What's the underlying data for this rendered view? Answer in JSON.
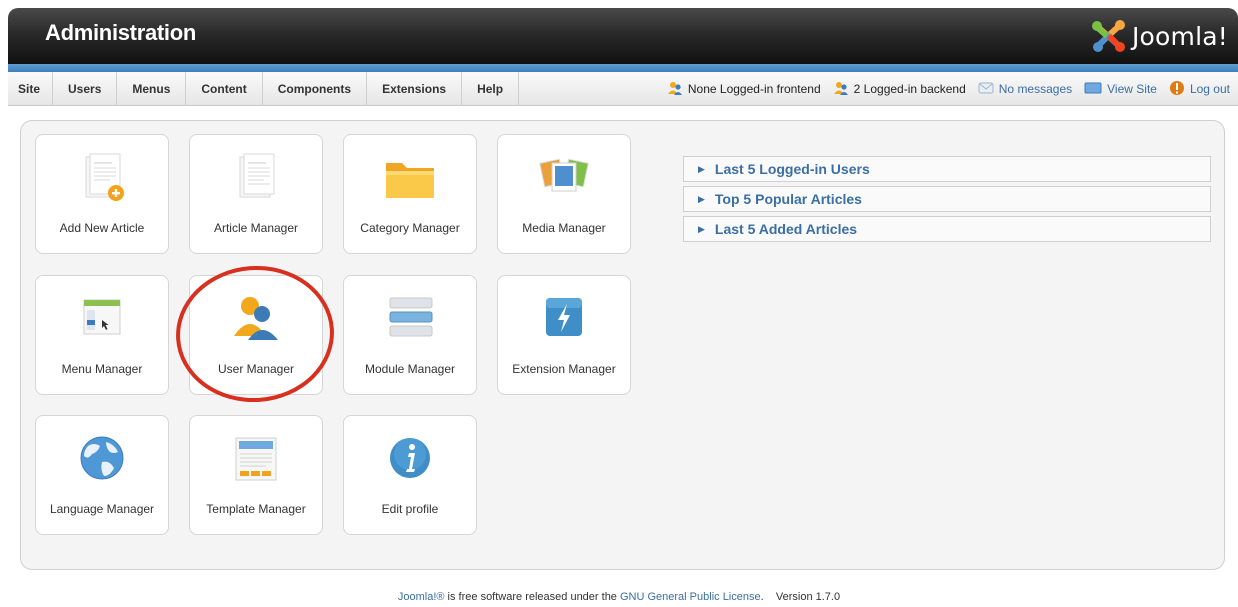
{
  "header": {
    "title": "Administration",
    "logo_text": "Joomla!"
  },
  "menubar": {
    "items": [
      "Site",
      "Users",
      "Menus",
      "Content",
      "Components",
      "Extensions",
      "Help"
    ]
  },
  "status": {
    "frontend": "None Logged-in frontend",
    "backend": "2 Logged-in backend",
    "messages": "No messages",
    "view_site": "View Site",
    "logout": "Log out"
  },
  "tiles": [
    {
      "label": "Add New Article",
      "icon": "add-article-icon"
    },
    {
      "label": "Article Manager",
      "icon": "article-icon"
    },
    {
      "label": "Category Manager",
      "icon": "folder-icon"
    },
    {
      "label": "Media Manager",
      "icon": "media-icon"
    },
    {
      "label": "Menu Manager",
      "icon": "menu-icon"
    },
    {
      "label": "User Manager",
      "icon": "users-icon"
    },
    {
      "label": "Module Manager",
      "icon": "module-icon"
    },
    {
      "label": "Extension Manager",
      "icon": "extension-icon"
    },
    {
      "label": "Language Manager",
      "icon": "globe-icon"
    },
    {
      "label": "Template Manager",
      "icon": "template-icon"
    },
    {
      "label": "Edit profile",
      "icon": "info-icon"
    }
  ],
  "panels": [
    "Last 5 Logged-in Users",
    "Top 5 Popular Articles",
    "Last 5 Added Articles"
  ],
  "footer": {
    "brand": "Joomla!®",
    "text1": " is free software released under the ",
    "license": "GNU General Public License",
    "text2": ".    Version 1.7.0"
  },
  "colors": {
    "accent": "#3a6fa5",
    "header_bg": "#222222",
    "annotation": "#d8301f"
  }
}
